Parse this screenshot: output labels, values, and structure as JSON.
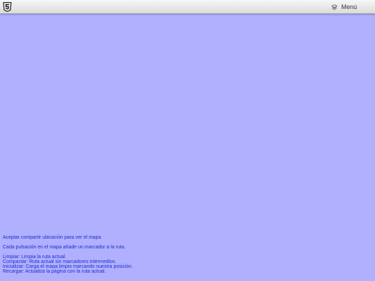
{
  "header": {
    "logo_icon": "html5-shield-icon",
    "menu_icon": "layers-icon",
    "menu_label": "Menú"
  },
  "info": {
    "share_notice": "Aceptar compartir ubicación para ver el mapa",
    "tap_hint": "Cada pulsación en el mapa añade un marcador a la ruta.",
    "help": [
      "Limpiar: Limpia la ruta actual.",
      "Compactar: Ruta actual sin marcadores intermedios.",
      "Inicializar: Carga el mapa limpio marcando nuestra posición.",
      "Recargar: Actualiza la página con la ruta actual."
    ]
  },
  "colors": {
    "map_background": "#b0b0ff",
    "info_text": "#1e2ec7",
    "toolbar": "#e8e8e8"
  }
}
